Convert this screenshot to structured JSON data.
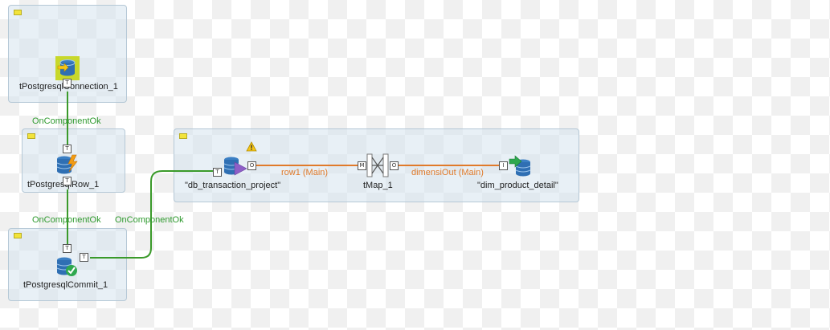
{
  "components": {
    "connection": {
      "label": "tPostgresqlConnection_1"
    },
    "row": {
      "label": "tPostgresqlRow_1"
    },
    "commit": {
      "label": "tPostgresqlCommit_1"
    },
    "input": {
      "label": "\"db_transaction_project\""
    },
    "map": {
      "label": "tMap_1"
    },
    "output": {
      "label": "\"dim_product_detail\""
    }
  },
  "triggers": {
    "conn_to_row": "OnComponentOk",
    "row_to_commit": "OnComponentOk",
    "commit_to_input": "OnComponentOk"
  },
  "flows": {
    "row1": "row1 (Main)",
    "dimensiOut": "dimensiOut (Main)"
  },
  "ports": {
    "trigger": "T",
    "output": "O",
    "map": "M",
    "input": "I"
  },
  "colors": {
    "trigger_link": "#3a9a2a",
    "main_link": "#e07a2a",
    "subjob_bg": "#d6e4ee",
    "collapse_button": "#f2e33b"
  }
}
